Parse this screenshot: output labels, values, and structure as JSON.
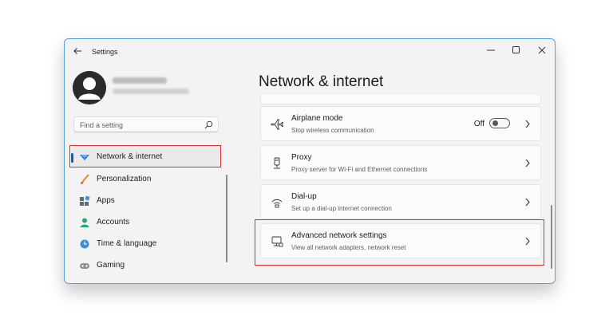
{
  "window": {
    "title": "Settings",
    "controls": {
      "minimize": "minimize-icon",
      "maximize": "maximize-icon",
      "close": "close-icon"
    }
  },
  "sidebar": {
    "search_placeholder": "Find a setting",
    "items": [
      {
        "label": "Network & internet",
        "icon": "wifi-diamond-icon",
        "selected": true
      },
      {
        "label": "Personalization",
        "icon": "paintbrush-icon"
      },
      {
        "label": "Apps",
        "icon": "apps-grid-icon"
      },
      {
        "label": "Accounts",
        "icon": "person-icon"
      },
      {
        "label": "Time & language",
        "icon": "globe-clock-icon"
      },
      {
        "label": "Gaming",
        "icon": "gamepad-icon"
      }
    ]
  },
  "main": {
    "title": "Network & internet",
    "cards": [
      {
        "title": "Airplane mode",
        "subtitle": "Stop wireless communication",
        "icon": "airplane-icon",
        "toggle_label": "Off"
      },
      {
        "title": "Proxy",
        "subtitle": "Proxy server for Wi-Fi and Ethernet connections",
        "icon": "proxy-icon"
      },
      {
        "title": "Dial-up",
        "subtitle": "Set up a dial-up internet connection",
        "icon": "dialup-icon"
      },
      {
        "title": "Advanced network settings",
        "subtitle": "View all network adapters, network reset",
        "icon": "monitor-network-icon",
        "highlighted": true
      }
    ]
  },
  "colors": {
    "accent": "#0067c0",
    "highlight": "#d9302c",
    "window_border": "#5aa0d8"
  }
}
